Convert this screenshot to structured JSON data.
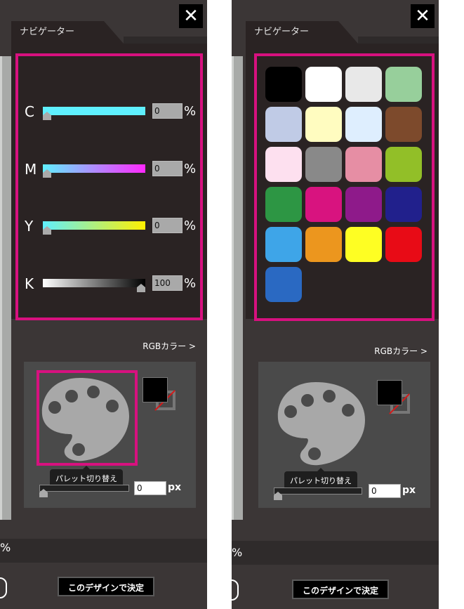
{
  "panels": [
    {
      "close_label": "✕",
      "tab_label": "ナビゲーター",
      "cmyk": [
        {
          "letter": "C",
          "value": "0",
          "gradient_start": "#5ff0ff",
          "gradient_end": "#5ff0ff"
        },
        {
          "letter": "M",
          "value": "0",
          "gradient_start": "#5ff0ff",
          "gradient_end": "#ff28ff"
        },
        {
          "letter": "Y",
          "value": "0",
          "gradient_start": "#5ff0ff",
          "gradient_end": "#fff000"
        },
        {
          "letter": "K",
          "value": "100",
          "gradient_start": "#ffffff",
          "gradient_end": "#000000"
        }
      ],
      "cmyk_percent": "%",
      "rgb_link": "RGBカラー >",
      "palette_tooltip": "パレット切り替え",
      "size_value": "0",
      "size_unit": "px",
      "bottom_percent": "%",
      "decide_button": "このデザインで決定"
    },
    {
      "close_label": "✕",
      "tab_label": "ナビゲーター",
      "swatches": [
        "#000000",
        "#ffffff",
        "#e8e8e8",
        "#97cf9b",
        "#c0cbe6",
        "#fffcc0",
        "#deeefe",
        "#7d4a2c",
        "#fde0ef",
        "#898989",
        "#e68ea4",
        "#92bf28",
        "#2d9644",
        "#d8137f",
        "#8e1a8a",
        "#21208c",
        "#3ea5e8",
        "#ec961e",
        "#fefe23",
        "#e80b16",
        "#2a69c2"
      ],
      "rgb_link": "RGBカラー >",
      "palette_tooltip": "パレット切り替え",
      "size_value": "0",
      "size_unit": "px",
      "bottom_percent": "%",
      "decide_button": "このデザインで決定"
    }
  ],
  "colors": {
    "highlight": "#d7117f",
    "panel_bg": "#3b3636",
    "content_bg": "#2a2323"
  }
}
